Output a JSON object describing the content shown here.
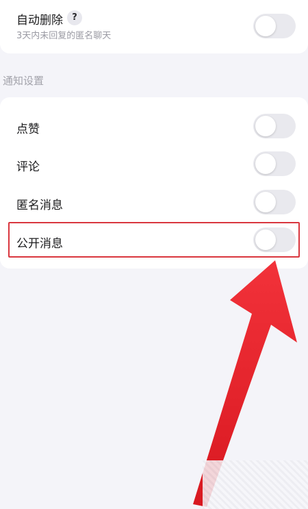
{
  "auto_delete": {
    "label": "自动删除",
    "help_badge": "?",
    "description": "3天内未回复的匿名聊天",
    "enabled": false
  },
  "notification_settings": {
    "section_title": "通知设置",
    "items": [
      {
        "label": "点赞",
        "enabled": false
      },
      {
        "label": "评论",
        "enabled": false
      },
      {
        "label": "匿名消息",
        "enabled": false
      },
      {
        "label": "公开消息",
        "enabled": false
      }
    ]
  },
  "colors": {
    "page_background": "#f4f4f9",
    "card_background": "#ffffff",
    "toggle_off": "#e9e9ee",
    "highlight_box": "#d9363e",
    "arrow": "#e8232c"
  },
  "annotation": {
    "highlighted_item": "公开消息"
  }
}
